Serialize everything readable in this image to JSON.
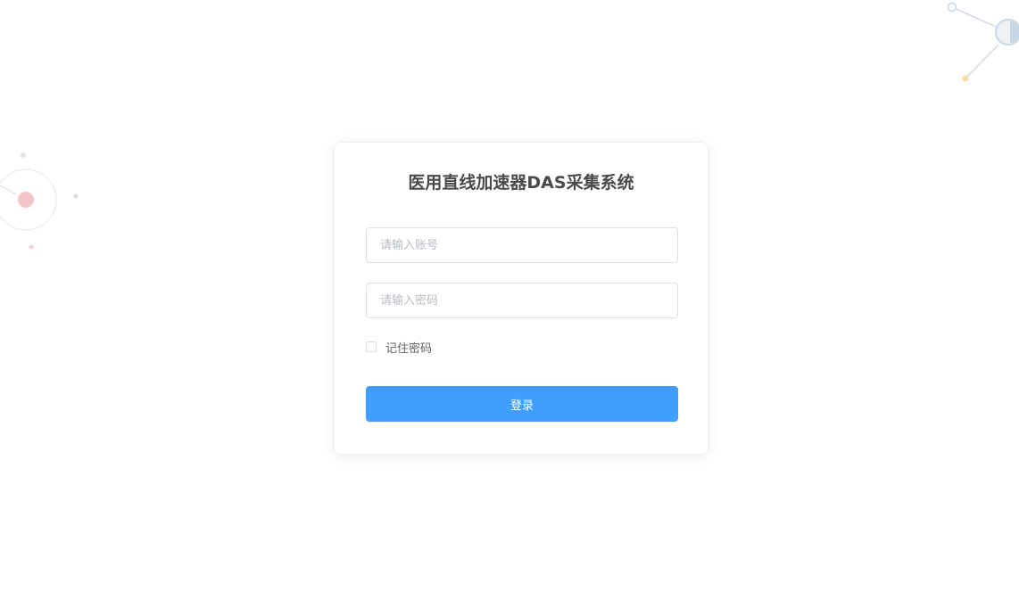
{
  "login": {
    "title": "医用直线加速器DAS采集系统",
    "account_placeholder": "请输入账号",
    "password_placeholder": "请输入密码",
    "remember_label": "记住密码",
    "remember_checked": false,
    "submit_label": "登录"
  },
  "colors": {
    "primary": "#409eff",
    "title": "#4a4a4a",
    "border": "#dcdfe6",
    "decor_pink": "#f4c6c9",
    "decor_blue": "#c9d6e6",
    "decor_yellow": "#f5dfa4"
  }
}
